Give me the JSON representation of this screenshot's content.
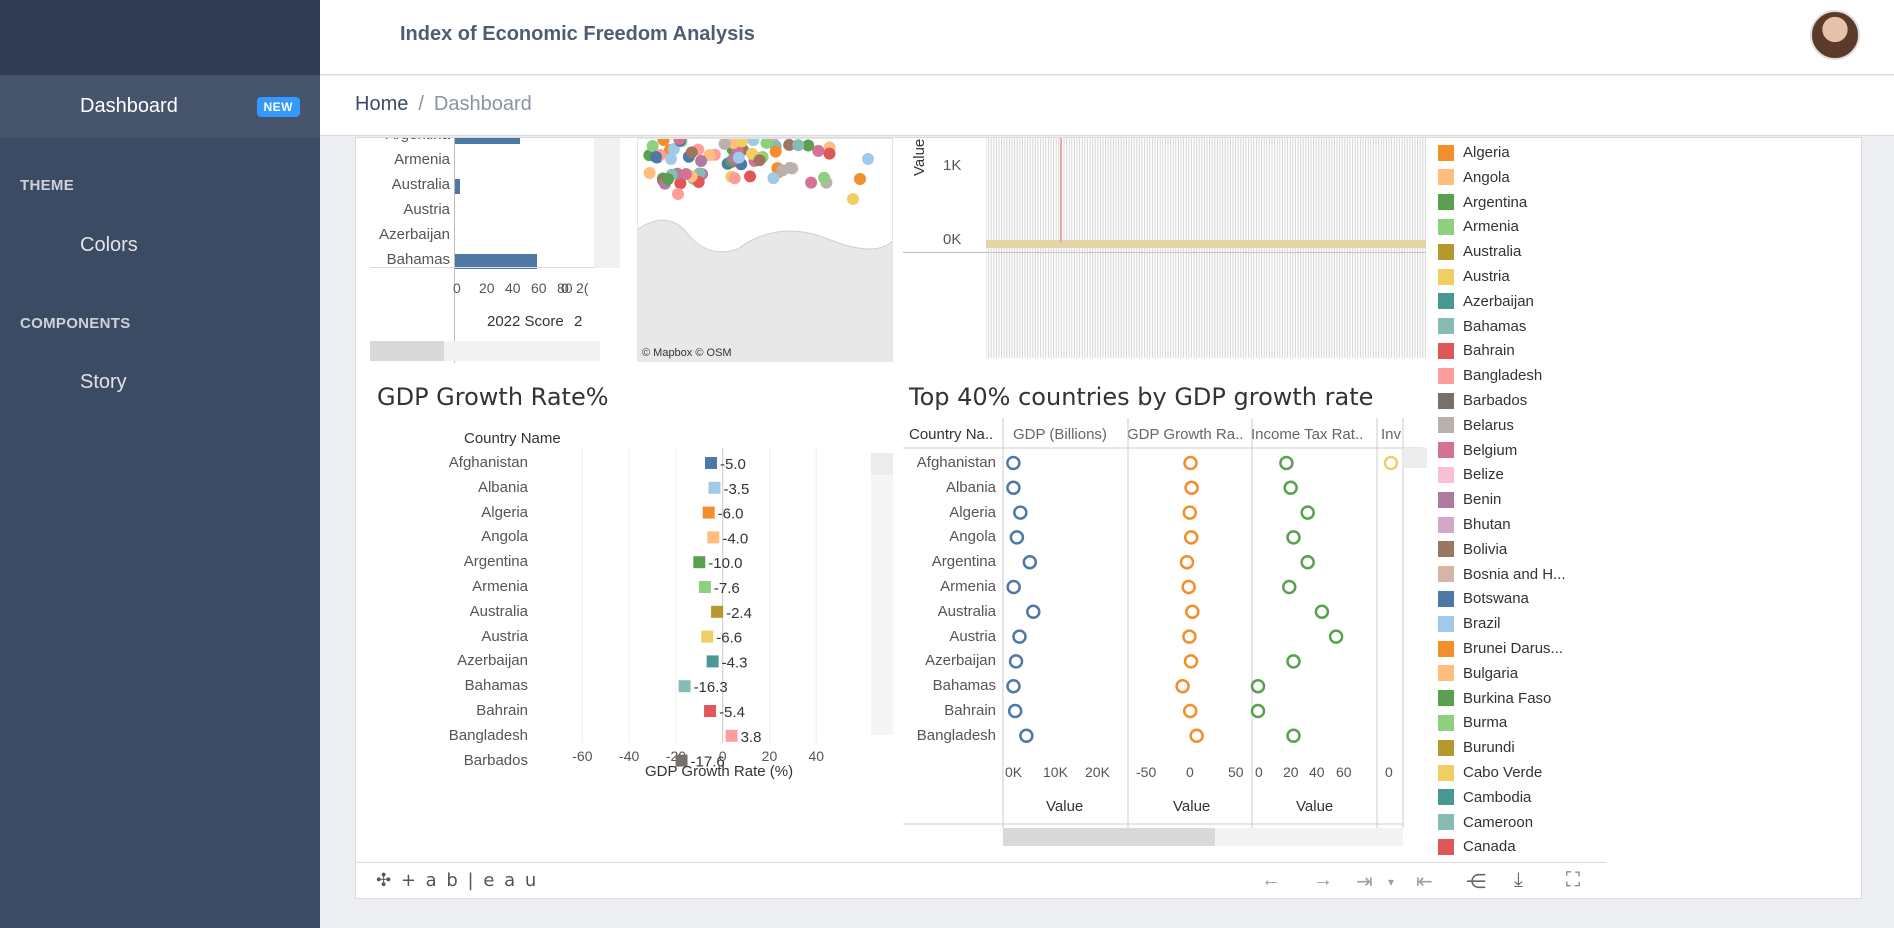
{
  "sidebar": {
    "active_item": "Dashboard",
    "active_badge": "NEW",
    "sections": [
      {
        "title": "THEME",
        "items": [
          "Colors"
        ]
      },
      {
        "title": "COMPONENTS",
        "items": [
          "Story"
        ]
      }
    ]
  },
  "header": {
    "title": "Index of Economic Freedom Analysis",
    "avatar_icon": "user-avatar"
  },
  "breadcrumb": {
    "home": "Home",
    "separator": "/",
    "current": "Dashboard"
  },
  "score_chart": {
    "countries": [
      "Argentina",
      "Armenia",
      "Australia",
      "Austria",
      "Azerbaijan",
      "Bahamas"
    ],
    "scores": [
      52,
      null,
      5,
      null,
      null,
      65
    ],
    "ticks": [
      "0",
      "20",
      "40",
      "60",
      "80"
    ],
    "second_tick": "0",
    "second_tick_cut": "2(",
    "axis_label": "2022 Score",
    "axis_label2": "2",
    "bar_color": "#4e79a7"
  },
  "map": {
    "attribution": "© Mapbox  © OSM"
  },
  "value_chart": {
    "ylabel": "Value",
    "ticks": [
      "1K",
      "0K"
    ]
  },
  "gdp_chart": {
    "title": "GDP Growth Rate%",
    "column_header": "Country Name",
    "xlabel": "GDP Growth Rate (%)",
    "ticks": [
      "-60",
      "-40",
      "-20",
      "0",
      "20",
      "40"
    ],
    "rows": [
      {
        "country": "Afghanistan",
        "value": -5.0,
        "label": "-5.0",
        "color": "#4e79a7"
      },
      {
        "country": "Albania",
        "value": -3.5,
        "label": "-3.5",
        "color": "#a0cbe8"
      },
      {
        "country": "Algeria",
        "value": -6.0,
        "label": "-6.0",
        "color": "#f28e2b"
      },
      {
        "country": "Angola",
        "value": -4.0,
        "label": "-4.0",
        "color": "#ffbe7d"
      },
      {
        "country": "Argentina",
        "value": -10.0,
        "label": "-10.0",
        "color": "#59a14f"
      },
      {
        "country": "Armenia",
        "value": -7.6,
        "label": "-7.6",
        "color": "#8cd17d"
      },
      {
        "country": "Australia",
        "value": -2.4,
        "label": "-2.4",
        "color": "#b6992d"
      },
      {
        "country": "Austria",
        "value": -6.6,
        "label": "-6.6",
        "color": "#f1ce63"
      },
      {
        "country": "Azerbaijan",
        "value": -4.3,
        "label": "-4.3",
        "color": "#499894"
      },
      {
        "country": "Bahamas",
        "value": -16.3,
        "label": "-16.3",
        "color": "#86bcb6"
      },
      {
        "country": "Bahrain",
        "value": -5.4,
        "label": "-5.4",
        "color": "#e15759"
      },
      {
        "country": "Bangladesh",
        "value": 3.8,
        "label": "3.8",
        "color": "#ff9d9a"
      },
      {
        "country": "Barbados",
        "value": -17.6,
        "label": "-17.6",
        "color": "#79706e"
      }
    ]
  },
  "top40_chart": {
    "title": "Top 40% countries by GDP growth rate",
    "headers": [
      "Country Na..",
      "GDP (Billions)",
      "GDP Growth Ra..",
      "Income Tax Rat..",
      "Inv"
    ],
    "countries": [
      "Afghanistan",
      "Albania",
      "Algeria",
      "Angola",
      "Argentina",
      "Armenia",
      "Australia",
      "Austria",
      "Azerbaijan",
      "Bahamas",
      "Bahrain",
      "Bangladesh"
    ],
    "gdp_billions": [
      80,
      100,
      1700,
      900,
      3900,
      150,
      4700,
      1500,
      700,
      110,
      500,
      3100
    ],
    "gdp_growth": [
      -5.0,
      -3.5,
      -6.0,
      -4.0,
      -10.0,
      -7.6,
      -2.4,
      -6.6,
      -4.3,
      -16.3,
      -5.4,
      3.8
    ],
    "income_tax": [
      20,
      23,
      35,
      25,
      35,
      22,
      45,
      55,
      25,
      0,
      0,
      25
    ],
    "gdp_ticks": [
      "0K",
      "10K",
      "20K"
    ],
    "growth_ticks": [
      "-50",
      "0",
      "50"
    ],
    "tax_ticks": [
      "0",
      "20",
      "40",
      "60"
    ],
    "inv_tick": "0",
    "xlabel": "Value",
    "colors": {
      "gdp": "#4e79a7",
      "growth": "#f28e2b",
      "tax": "#59a14f",
      "inv": "#f1ce63"
    }
  },
  "legend": [
    {
      "label": "Algeria",
      "color": "#f28e2b"
    },
    {
      "label": "Angola",
      "color": "#ffbe7d"
    },
    {
      "label": "Argentina",
      "color": "#59a14f"
    },
    {
      "label": "Armenia",
      "color": "#8cd17d"
    },
    {
      "label": "Australia",
      "color": "#b6992d"
    },
    {
      "label": "Austria",
      "color": "#f1ce63"
    },
    {
      "label": "Azerbaijan",
      "color": "#499894"
    },
    {
      "label": "Bahamas",
      "color": "#86bcb6"
    },
    {
      "label": "Bahrain",
      "color": "#e15759"
    },
    {
      "label": "Bangladesh",
      "color": "#ff9d9a"
    },
    {
      "label": "Barbados",
      "color": "#79706e"
    },
    {
      "label": "Belarus",
      "color": "#bab0ac"
    },
    {
      "label": "Belgium",
      "color": "#d37295"
    },
    {
      "label": "Belize",
      "color": "#fabfd2"
    },
    {
      "label": "Benin",
      "color": "#b07aa1"
    },
    {
      "label": "Bhutan",
      "color": "#d4a6c8"
    },
    {
      "label": "Bolivia",
      "color": "#9d7660"
    },
    {
      "label": "Bosnia and H...",
      "color": "#d7b5a6"
    },
    {
      "label": "Botswana",
      "color": "#4e79a7"
    },
    {
      "label": "Brazil",
      "color": "#a0cbe8"
    },
    {
      "label": "Brunei Darus...",
      "color": "#f28e2b"
    },
    {
      "label": "Bulgaria",
      "color": "#ffbe7d"
    },
    {
      "label": "Burkina Faso",
      "color": "#59a14f"
    },
    {
      "label": "Burma",
      "color": "#8cd17d"
    },
    {
      "label": "Burundi",
      "color": "#b6992d"
    },
    {
      "label": "Cabo Verde",
      "color": "#f1ce63"
    },
    {
      "label": "Cambodia",
      "color": "#499894"
    },
    {
      "label": "Cameroon",
      "color": "#86bcb6"
    },
    {
      "label": "Canada",
      "color": "#e15759"
    }
  ],
  "toolbar": {
    "brand": "+ a b | e a u",
    "icons": [
      "undo-icon",
      "redo-icon",
      "revert-icon",
      "reset-icon",
      "share-icon",
      "download-icon",
      "fullscreen-icon"
    ]
  }
}
